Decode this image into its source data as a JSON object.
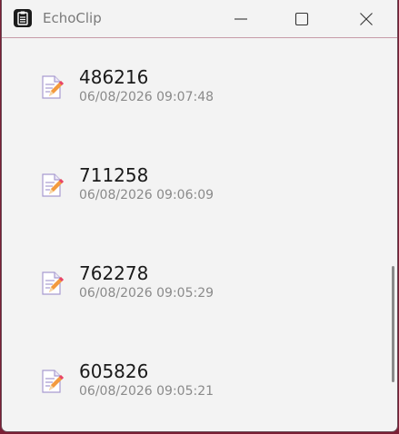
{
  "window": {
    "title": "EchoClip"
  },
  "clips": [
    {
      "text": "486216",
      "time": "06/08/2026 09:07:48"
    },
    {
      "text": "711258",
      "time": "06/08/2026 09:06:09"
    },
    {
      "text": "762278",
      "time": "06/08/2026 09:05:29"
    },
    {
      "text": "605826",
      "time": "06/08/2026 09:05:21"
    }
  ],
  "colors": {
    "desktop": "#7a1f35",
    "window_bg": "#f3f3f3",
    "title_text": "#7a7a7a",
    "clip_text": "#1a1a1a",
    "time_text": "#8a8a8a"
  }
}
